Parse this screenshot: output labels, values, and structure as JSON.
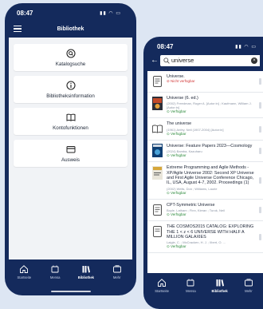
{
  "phone1": {
    "time": "08:47",
    "title": "Bibliothek",
    "menu": [
      {
        "label": "Katalogsuche",
        "icon": "search-icon"
      },
      {
        "label": "Bibliotheksinformation",
        "icon": "info-icon"
      },
      {
        "label": "Kontofunktionen",
        "icon": "book-icon"
      },
      {
        "label": "Ausweis",
        "icon": "card-icon"
      }
    ],
    "tabs": [
      {
        "label": "Startseite",
        "icon": "home-icon"
      },
      {
        "label": "Mensa",
        "icon": "food-icon"
      },
      {
        "label": "Bibliothek",
        "icon": "library-icon"
      },
      {
        "label": "Mehr",
        "icon": "more-icon"
      }
    ]
  },
  "phone2": {
    "time": "08:47",
    "search_query": "universe",
    "results": [
      {
        "title": "Universe.",
        "meta": "",
        "status": "Nicht verfügbar",
        "available": false,
        "thumb": "document-icon"
      },
      {
        "title": "Universe (6. ed.)",
        "meta": "(2002) Freedman, Roger A. [Autor:in] ; Kaufmann, William J. [Autor:in]",
        "status": "Verfügbar",
        "available": true,
        "thumb": "cover-image"
      },
      {
        "title": "The universe",
        "meta": "(1961) Anfey, Neil (1907-2004) [Autor:in]",
        "status": "Verfügbar",
        "available": true,
        "thumb": "book-icon"
      },
      {
        "title": "Universe: Feature Papers 2023—Cosmology",
        "meta": "(2024) Bamba, Kazuharu",
        "status": "Verfügbar",
        "available": true,
        "thumb": "cover-image"
      },
      {
        "title": "Extreme Programming and Agile Methods - XP/Agile Universe 2002: Second XP Universe and First Agile Universe Conference Chicago, IL, USA, August 4-7, 2002. Proceedings (1)",
        "meta": "(2002) Wells, Don ; Williams, Laurie",
        "status": "Verfügbar",
        "available": true,
        "thumb": "cover-image"
      },
      {
        "title": "CPT-Symmetric Universe",
        "meta": "Boyle, Latham ; Finn, Kieran ; Turok, Neil",
        "status": "Verfügbar",
        "available": true,
        "thumb": "document-icon"
      },
      {
        "title": "THE COSMOS2015 CATALOG: EXPLORING THE 1 < z < 6 UNIVERSE WITH HALF A MILLION GALAXIES",
        "meta": "Laigle, C. ; McCracken, H. J. ; Ilbert, O. ...",
        "status": "Verfügbar",
        "available": true,
        "thumb": "document-icon"
      }
    ],
    "tabs": [
      {
        "label": "Startseite",
        "icon": "home-icon"
      },
      {
        "label": "Mensa",
        "icon": "food-icon"
      },
      {
        "label": "Bibliothek",
        "icon": "library-icon"
      },
      {
        "label": "Mehr",
        "icon": "more-icon"
      }
    ],
    "active_tab": "Bibliothek"
  },
  "colors": {
    "navy": "#142a5c",
    "available": "#2e8b3e",
    "unavailable": "#d23a3a"
  }
}
